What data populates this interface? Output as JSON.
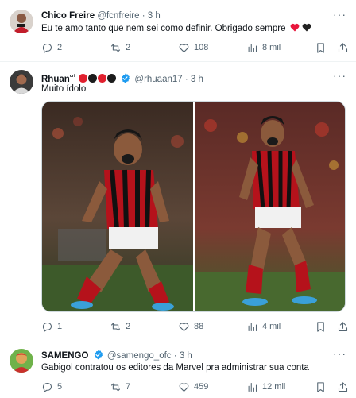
{
  "tweets": [
    {
      "name": "Chico Freire",
      "handle": "@fcnfreire",
      "time": "3 h",
      "text": "Eu te amo tanto que nem sei como definir. Obrigado sempre",
      "emoji": [
        "red-heart",
        "black-heart"
      ],
      "replies": "2",
      "retweets": "2",
      "likes": "108",
      "views": "8 mil"
    },
    {
      "name": "Rhuan",
      "name_suffix": "ᶜʳᶠ",
      "handle": "@rhuaan17",
      "time": "3 h",
      "text": "Muito ídolo",
      "name_emoji": [
        "red-circle",
        "black-circle",
        "red-circle",
        "black-circle"
      ],
      "replies": "1",
      "retweets": "2",
      "likes": "88",
      "views": "4 mil"
    },
    {
      "name": "SAMENGO",
      "handle": "@samengo_ofc",
      "time": "3 h",
      "text": "Gabigol contratou os editores da Marvel pra administrar sua conta",
      "replies": "5",
      "retweets": "7",
      "likes": "459",
      "views": "12 mil"
    }
  ],
  "separator": "·",
  "more_label": "···",
  "colors": {
    "verified": "#1d9bf0",
    "heart_red": "#e8163c",
    "heart_black": "#222222",
    "circle_red": "#e0202e",
    "circle_black": "#1c1c1c",
    "muted": "#536471"
  }
}
